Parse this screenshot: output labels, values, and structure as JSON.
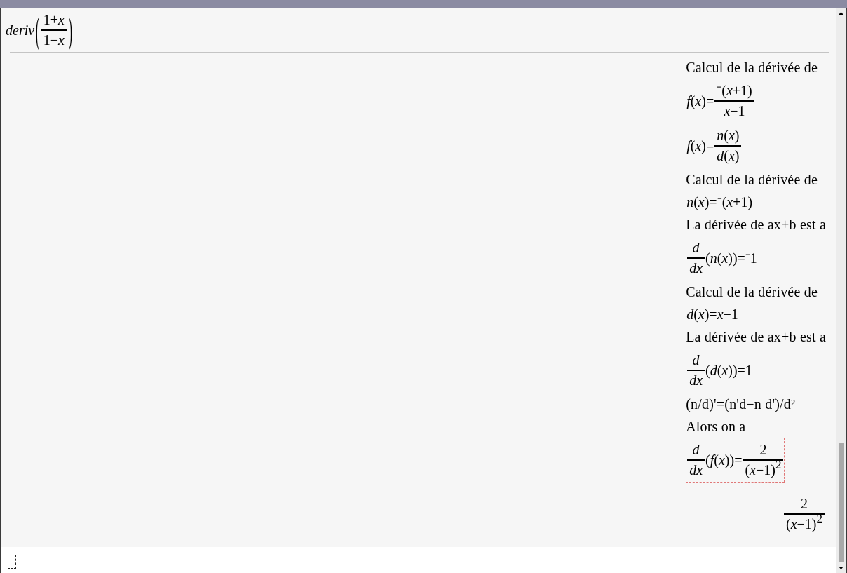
{
  "history": [
    {
      "input": [
        {
          "kind": "text",
          "text": "*deriv*"
        },
        {
          "kind": "group",
          "open": "(",
          "close": ")",
          "body": [
            {
              "kind": "frac",
              "num": [
                {
                  "kind": "text",
                  "text": "1+*x*"
                }
              ],
              "den": [
                {
                  "kind": "text",
                  "text": "1−*x*"
                }
              ]
            }
          ]
        }
      ],
      "steps": [
        {
          "kind": "prose",
          "text": "Calcul de la dérivée de",
          "selected": false
        },
        {
          "kind": "math",
          "selected": false,
          "math": [
            {
              "kind": "text",
              "text": "*f*(*x*)="
            },
            {
              "kind": "frac",
              "num": [
                {
                  "kind": "text",
                  "text": "⁻(*x*+1)"
                }
              ],
              "den": [
                {
                  "kind": "text",
                  "text": "*x*−1"
                }
              ]
            }
          ]
        },
        {
          "kind": "math",
          "selected": false,
          "math": [
            {
              "kind": "text",
              "text": "*f*(*x*)="
            },
            {
              "kind": "frac",
              "num": [
                {
                  "kind": "text",
                  "text": "*n*(*x*)"
                }
              ],
              "den": [
                {
                  "kind": "text",
                  "text": "*d*(*x*)"
                }
              ]
            }
          ]
        },
        {
          "kind": "prose",
          "text": "Calcul de la dérivée de",
          "selected": false
        },
        {
          "kind": "math",
          "selected": false,
          "math": [
            {
              "kind": "text",
              "text": "*n*(*x*)=⁻(*x*+1)"
            }
          ]
        },
        {
          "kind": "prose",
          "text": "La dérivée de ax+b est a",
          "selected": false
        },
        {
          "kind": "math",
          "selected": false,
          "math": [
            {
              "kind": "frac",
              "num": [
                {
                  "kind": "text",
                  "text": "*d*"
                }
              ],
              "den": [
                {
                  "kind": "text",
                  "text": "*dx*"
                }
              ]
            },
            {
              "kind": "text",
              "text": "(*n*(*x*))=⁻1"
            }
          ]
        },
        {
          "kind": "prose",
          "text": "Calcul de la dérivée de",
          "selected": false
        },
        {
          "kind": "math",
          "selected": false,
          "math": [
            {
              "kind": "text",
              "text": "*d*(*x*)=*x*−1"
            }
          ]
        },
        {
          "kind": "prose",
          "text": "La dérivée de ax+b est a",
          "selected": false
        },
        {
          "kind": "math",
          "selected": false,
          "math": [
            {
              "kind": "frac",
              "num": [
                {
                  "kind": "text",
                  "text": "*d*"
                }
              ],
              "den": [
                {
                  "kind": "text",
                  "text": "*dx*"
                }
              ]
            },
            {
              "kind": "text",
              "text": "(*d*(*x*))=1"
            }
          ]
        },
        {
          "kind": "prose",
          "text": "(n/d)'=(n'd−n d')/d²",
          "selected": false
        },
        {
          "kind": "prose",
          "text": "Alors on a",
          "selected": false
        },
        {
          "kind": "math",
          "selected": true,
          "math": [
            {
              "kind": "frac",
              "num": [
                {
                  "kind": "text",
                  "text": "*d*"
                }
              ],
              "den": [
                {
                  "kind": "text",
                  "text": "*dx*"
                }
              ]
            },
            {
              "kind": "text",
              "text": "(*f*(*x*))="
            },
            {
              "kind": "frac",
              "num": [
                {
                  "kind": "text",
                  "text": "2"
                }
              ],
              "den": [
                {
                  "kind": "text",
                  "text": "(*x*−1)$^{2}$"
                }
              ]
            }
          ]
        }
      ],
      "result": [
        {
          "kind": "frac",
          "num": [
            {
              "kind": "text",
              "text": "2"
            }
          ],
          "den": [
            {
              "kind": "text",
              "text": "(*x*−1)$^{2}$"
            }
          ]
        }
      ]
    }
  ]
}
